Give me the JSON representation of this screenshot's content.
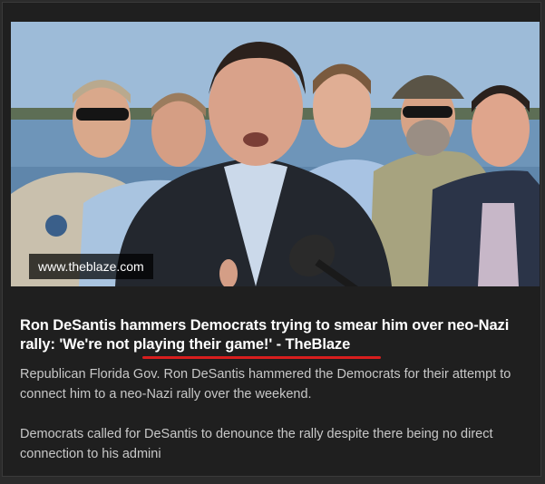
{
  "card": {
    "source_domain": "www.theblaze.com",
    "headline": "Ron DeSantis hammers Democrats trying to smear him over neo-Nazi rally: 'We're not playing their game!' - TheBlaze",
    "description_paragraphs": [
      "Republican Florida Gov. Ron DeSantis hammered the Democrats for their attempt to connect him to a neo-Nazi rally over the weekend.",
      "Democrats called for DeSantis to denounce the rally despite there being no direct connection to his admini"
    ]
  },
  "colors": {
    "background": "#1f1f1f",
    "headline_text": "#ffffff",
    "description_text": "#c8c8c8",
    "underline_accent": "#d81e1e"
  }
}
